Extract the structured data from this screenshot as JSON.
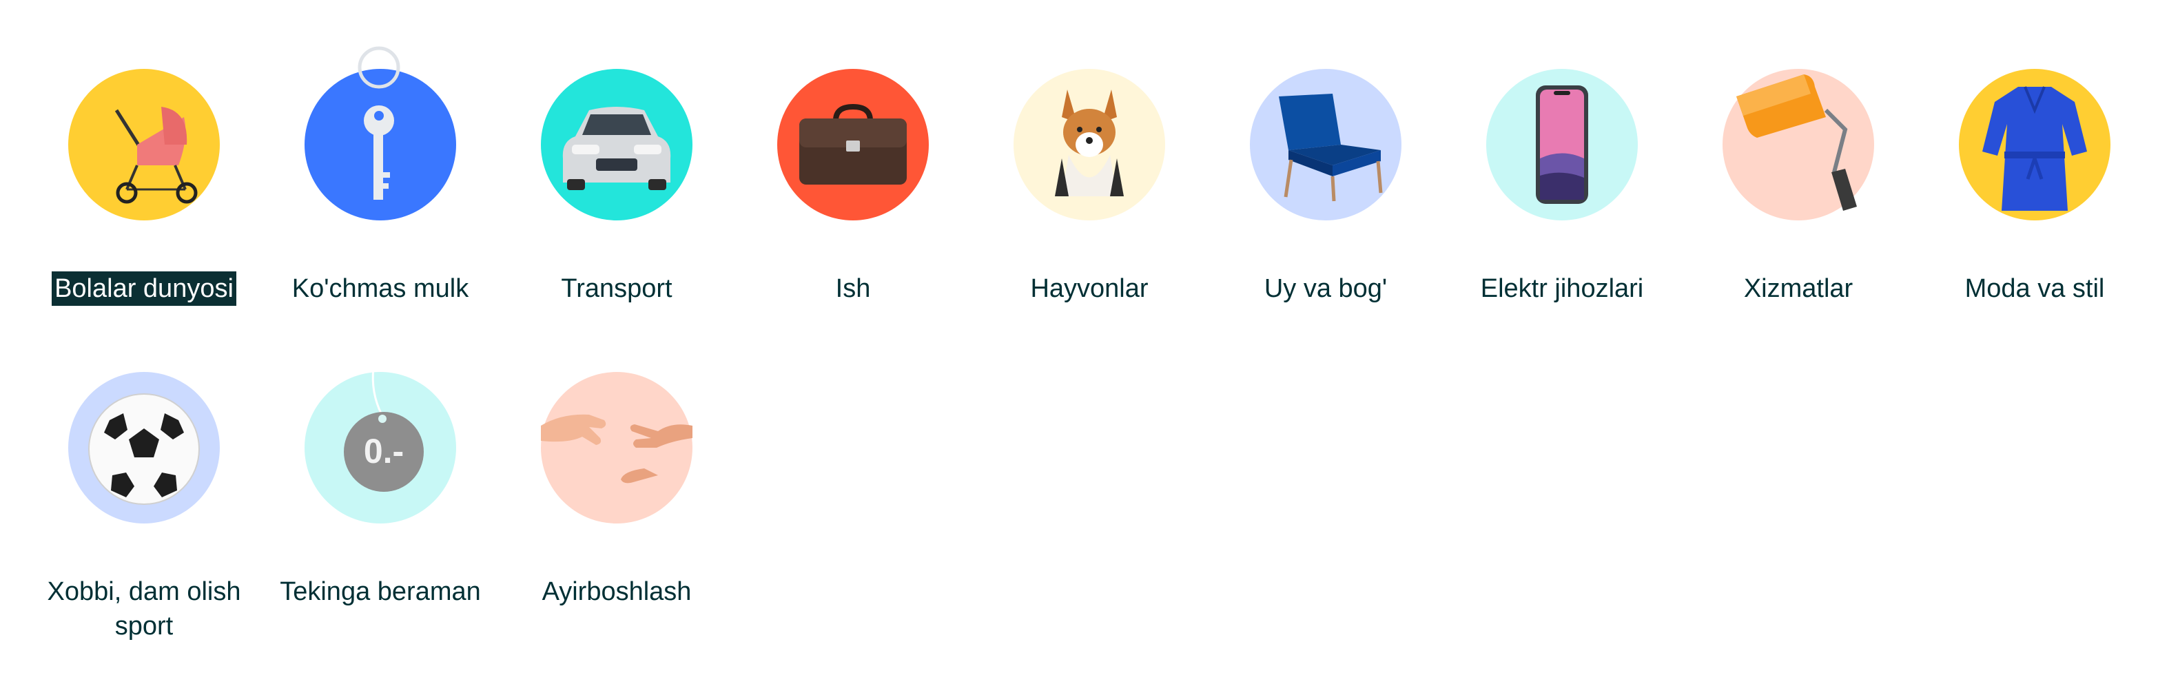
{
  "categories": [
    {
      "label": "Bolalar dunyosi",
      "icon": "stroller-icon",
      "bg": "#ffce32",
      "selected": true
    },
    {
      "label": "Ko'chmas mulk",
      "icon": "key-icon",
      "bg": "#3a77ff"
    },
    {
      "label": "Transport",
      "icon": "car-icon",
      "bg": "#23e5db"
    },
    {
      "label": "Ish",
      "icon": "briefcase-icon",
      "bg": "#ff5636"
    },
    {
      "label": "Hayvonlar",
      "icon": "dog-icon",
      "bg": "#fff6d9"
    },
    {
      "label": "Uy va bog'",
      "icon": "armchair-icon",
      "bg": "#cbdaff"
    },
    {
      "label": "Elektr jihozlari",
      "icon": "smartphone-icon",
      "bg": "#c8f8f6"
    },
    {
      "label": "Xizmatlar",
      "icon": "paint-roller-icon",
      "bg": "#ffd6c9"
    },
    {
      "label": "Moda va stil",
      "icon": "dress-icon",
      "bg": "#ffce32"
    },
    {
      "label_lines": [
        "Xobbi, dam olish",
        "sport"
      ],
      "icon": "soccer-ball-icon",
      "bg": "#cbdaff"
    },
    {
      "label": "Tekinga beraman",
      "icon": "price-tag-icon",
      "bg": "#c8f8f6"
    },
    {
      "label": "Ayirboshlash",
      "icon": "handshake-icon",
      "bg": "#ffd6c9"
    }
  ]
}
